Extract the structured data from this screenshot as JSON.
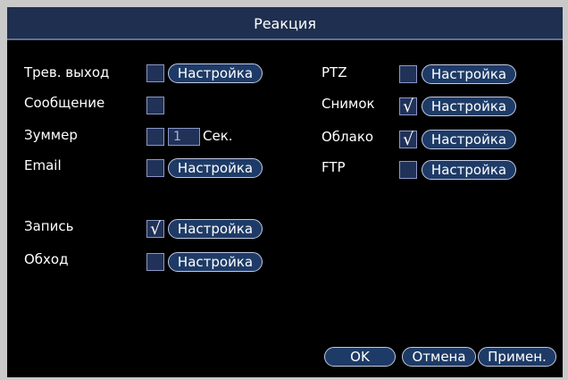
{
  "window": {
    "title": "Реакция"
  },
  "left": {
    "alarm_out": {
      "label": "Трев. выход",
      "checked": false,
      "button": "Настройка"
    },
    "message": {
      "label": "Сообщение",
      "checked": false
    },
    "buzzer": {
      "label": "Зуммер",
      "checked": false,
      "value": "1",
      "unit": "Сек."
    },
    "email": {
      "label": "Email",
      "checked": false,
      "button": "Настройка"
    },
    "record": {
      "label": "Запись",
      "checked": true,
      "button": "Настройка"
    },
    "tour": {
      "label": "Обход",
      "checked": false,
      "button": "Настройка"
    }
  },
  "right": {
    "ptz": {
      "label": "PTZ",
      "checked": false,
      "button": "Настройка"
    },
    "snapshot": {
      "label": "Снимок",
      "checked": true,
      "button": "Настройка"
    },
    "cloud": {
      "label": "Облако",
      "checked": true,
      "button": "Настройка"
    },
    "ftp": {
      "label": "FTP",
      "checked": false,
      "button": "Настройка"
    }
  },
  "footer": {
    "ok": "OK",
    "cancel": "Отмена",
    "apply": "Примен."
  },
  "colors": {
    "accent": "#1e3b67",
    "titlebar": "#1f2f4f",
    "border": "#c2c9e4"
  }
}
